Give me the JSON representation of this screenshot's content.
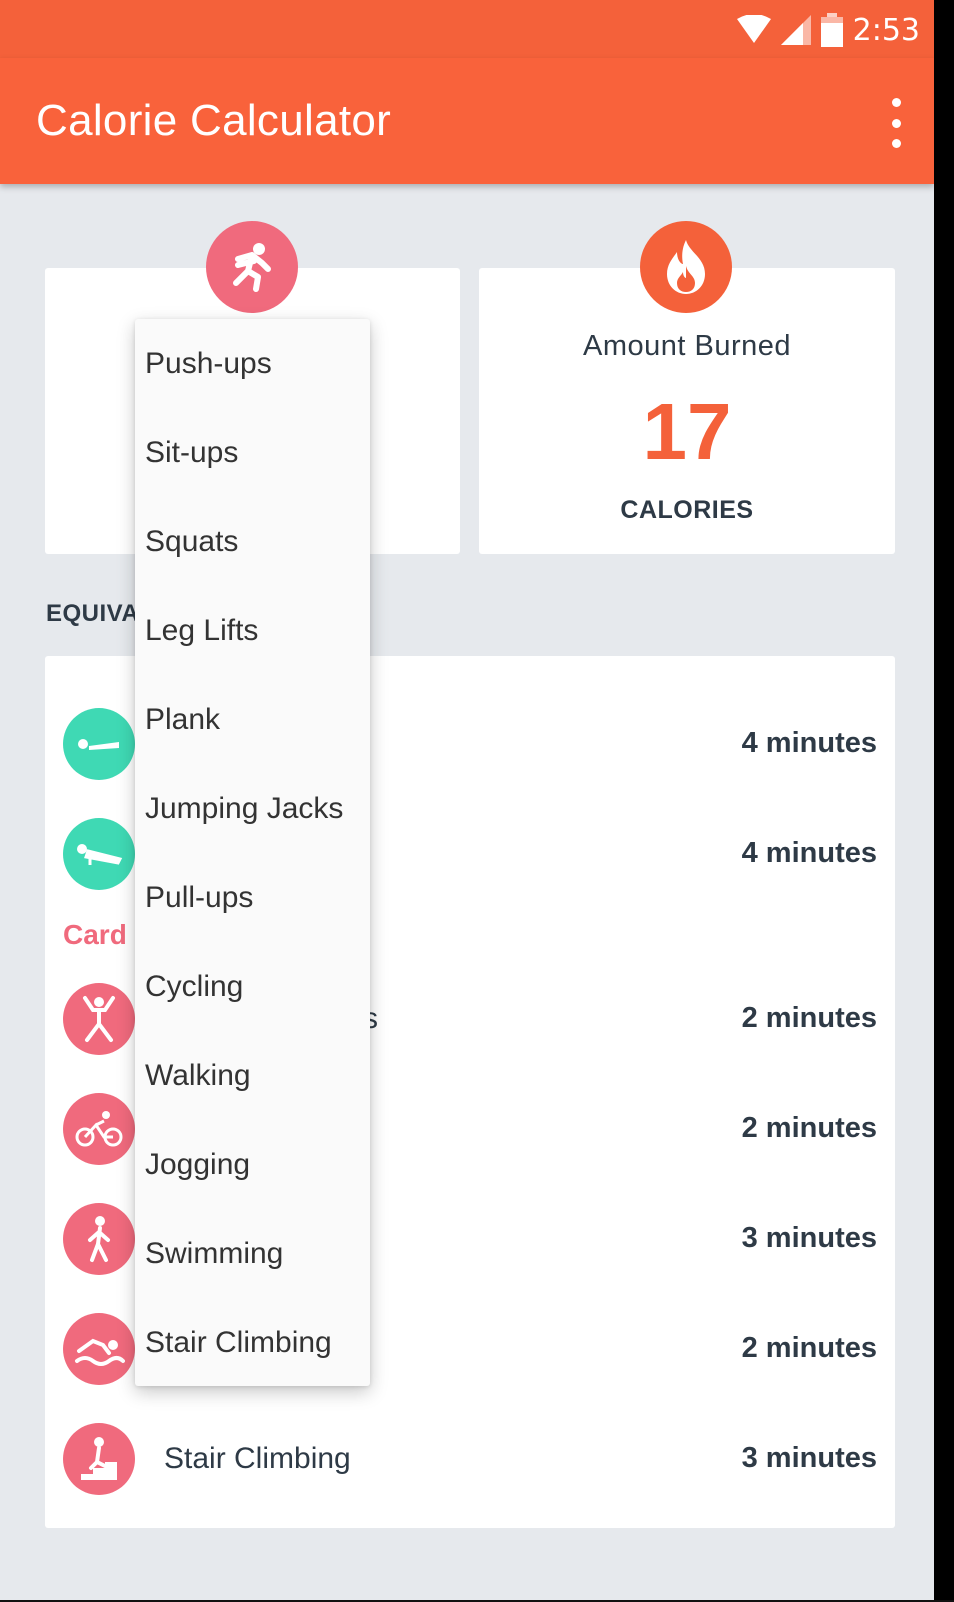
{
  "status_bar": {
    "time": "2:53",
    "icons": [
      "wifi-icon",
      "signal-icon",
      "battery-icon"
    ]
  },
  "app_bar": {
    "title": "Calorie Calculator",
    "menu_icon": "more-vert-icon"
  },
  "activity_card": {
    "icon": "running-person-icon"
  },
  "burned_card": {
    "icon": "flame-icon",
    "label": "Amount Burned",
    "value": "17",
    "unit": "CALORIES"
  },
  "equivalent": {
    "heading": "EQUIVA",
    "heading_tail": "S",
    "category_label": "Card",
    "rows": [
      {
        "icon": "plank-icon",
        "label": "",
        "value": "4 minutes"
      },
      {
        "icon": "push-up-icon",
        "label": "",
        "value": "4 minutes"
      },
      {
        "icon": "jumping-jacks-icon",
        "label": "s",
        "value": "2 minutes"
      },
      {
        "icon": "cycling-icon",
        "label": "",
        "value": "2 minutes"
      },
      {
        "icon": "walking-icon",
        "label": "",
        "value": "3 minutes"
      },
      {
        "icon": "swimming-icon",
        "label": "",
        "value": "2 minutes"
      },
      {
        "icon": "stair-climbing-icon",
        "label": "Stair Climbing",
        "value": "3 minutes"
      }
    ]
  },
  "dropdown": {
    "items": [
      "Push-ups",
      "Sit-ups",
      "Squats",
      "Leg Lifts",
      "Plank",
      "Jumping Jacks",
      "Pull-ups",
      "Cycling",
      "Walking",
      "Jogging",
      "Swimming",
      "Stair Climbing"
    ]
  },
  "colors": {
    "accent": "#f9623b",
    "teal": "#3fd9b4",
    "pink": "#f06a7d",
    "text": "#2e3a46",
    "background": "#e6e9ed"
  }
}
